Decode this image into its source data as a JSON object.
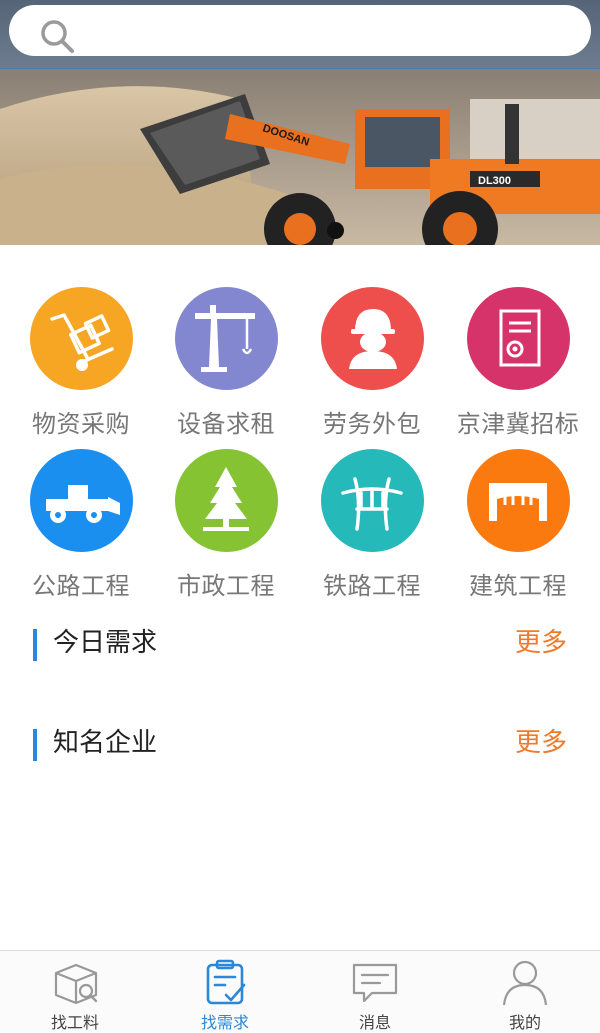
{
  "search": {
    "placeholder": ""
  },
  "banner": {
    "brand_text": "DOOSAN",
    "model_text": "DL300"
  },
  "categories": [
    {
      "label": "物资采购",
      "icon": "hand-truck-icon",
      "color": "#f6a623"
    },
    {
      "label": "设备求租",
      "icon": "tower-crane-icon",
      "color": "#8387cf"
    },
    {
      "label": "劳务外包",
      "icon": "worker-icon",
      "color": "#ee4e4c"
    },
    {
      "label": "京津冀招标",
      "icon": "document-gear-icon",
      "color": "#d7336b"
    },
    {
      "label": "公路工程",
      "icon": "loader-icon",
      "color": "#1a8ff0"
    },
    {
      "label": "市政工程",
      "icon": "tree-icon",
      "color": "#86c332"
    },
    {
      "label": "铁路工程",
      "icon": "bridge-icon",
      "color": "#26b9b9"
    },
    {
      "label": "建筑工程",
      "icon": "arch-bridge-icon",
      "color": "#fb7a10"
    }
  ],
  "sections": [
    {
      "title": "今日需求",
      "more": "更多"
    },
    {
      "title": "知名企业",
      "more": "更多"
    }
  ],
  "bottom_nav": [
    {
      "label": "找工料",
      "icon": "box-search-icon",
      "active": false
    },
    {
      "label": "找需求",
      "icon": "clipboard-check-icon",
      "active": true
    },
    {
      "label": "消息",
      "icon": "chat-icon",
      "active": false
    },
    {
      "label": "我的",
      "icon": "user-icon",
      "active": false
    }
  ],
  "colors": {
    "accent": "#2b87d7",
    "more": "#f07a2a"
  }
}
